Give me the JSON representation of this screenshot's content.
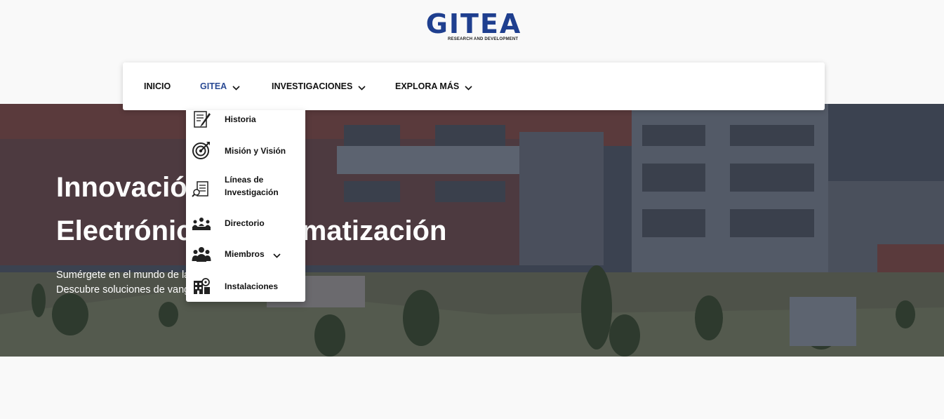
{
  "logo": {
    "wordmark": "GITEA",
    "tagline": "RESEARCH AND DEVELOPMENT"
  },
  "nav": {
    "items": [
      {
        "label": "INICIO"
      },
      {
        "label": "GITEA"
      },
      {
        "label": "INVESTIGACIONES"
      },
      {
        "label": "EXPLORA MÁS"
      }
    ]
  },
  "dropdown": {
    "items": [
      {
        "label": "Historia",
        "icon": "history-icon"
      },
      {
        "label": "Misión y Visión",
        "icon": "target-icon"
      },
      {
        "label_line1": "Líneas de",
        "label_line2": "Investigación",
        "icon": "research-lines-icon"
      },
      {
        "label": "Directorio",
        "icon": "directory-icon"
      },
      {
        "label": "Miembros",
        "icon": "members-icon"
      },
      {
        "label": "Instalaciones",
        "icon": "facilities-icon"
      }
    ]
  },
  "hero": {
    "title_line1": "Innovación en",
    "title_line2": "Electrónica y Automatización",
    "text_line1": "Sumérgete en el mundo de la investigación del GITEA",
    "text_line2": "Descubre soluciones de vanguardia en automatización"
  },
  "colors": {
    "brand": "#1f3f8f",
    "active_nav": "#2a4a94"
  }
}
